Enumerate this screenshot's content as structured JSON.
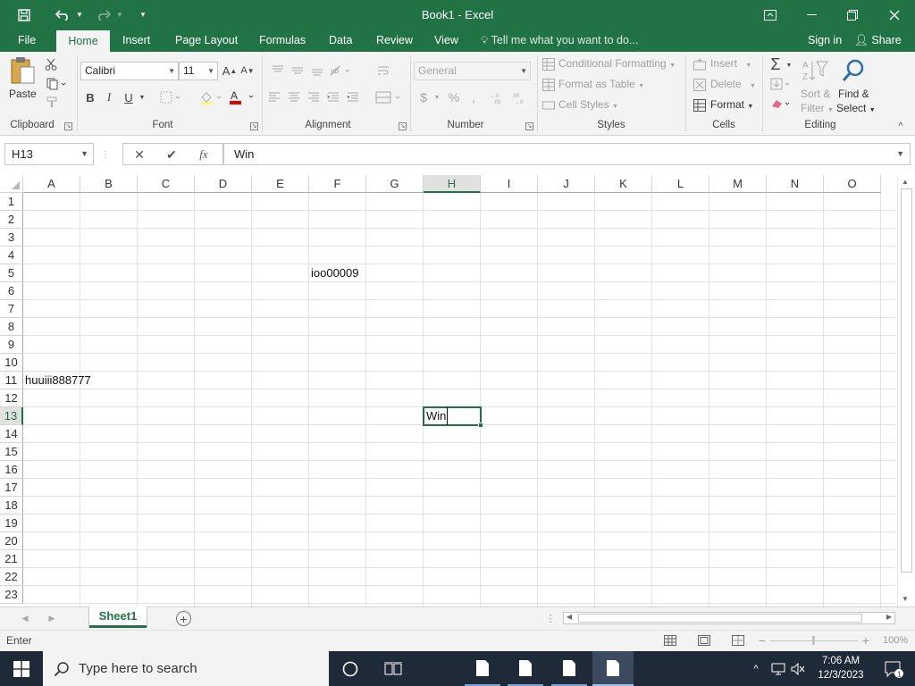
{
  "app": {
    "title": "Book1 - Excel"
  },
  "titlebar": {
    "icons": [
      "save-icon",
      "undo-icon",
      "redo-icon",
      "customize-quick-access-icon",
      "ribbon-display-options-icon",
      "minimize-icon",
      "restore-icon",
      "close-icon"
    ]
  },
  "tabs": [
    {
      "label": "File"
    },
    {
      "label": "Home",
      "active": true
    },
    {
      "label": "Insert"
    },
    {
      "label": "Page Layout"
    },
    {
      "label": "Formulas"
    },
    {
      "label": "Data"
    },
    {
      "label": "Review"
    },
    {
      "label": "View"
    }
  ],
  "tell_me": "Tell me what you want to do...",
  "signin": "Sign in",
  "share": "Share",
  "ribbon": {
    "clipboard": {
      "label": "Clipboard",
      "paste": "Paste"
    },
    "font": {
      "label": "Font",
      "name": "Calibri",
      "size": "11",
      "bold": "B",
      "italic": "I",
      "underline": "U"
    },
    "alignment": {
      "label": "Alignment"
    },
    "number": {
      "label": "Number",
      "format": "General",
      "currency": "$",
      "percent": "%"
    },
    "styles": {
      "label": "Styles",
      "conditional": "Conditional Formatting",
      "format_table": "Format as Table",
      "cell_styles": "Cell Styles"
    },
    "cells": {
      "label": "Cells",
      "insert": "Insert",
      "delete": "Delete",
      "format": "Format"
    },
    "editing": {
      "label": "Editing",
      "sort_filter_1": "Sort &",
      "sort_filter_2": "Filter",
      "find_select_1": "Find &",
      "find_select_2": "Select"
    }
  },
  "formula_bar": {
    "name_box": "H13",
    "cancel": "✕",
    "enter": "✔",
    "fx": "fx",
    "content": "Win"
  },
  "columns": [
    "A",
    "B",
    "C",
    "D",
    "E",
    "F",
    "G",
    "H",
    "I",
    "J",
    "K",
    "L",
    "M",
    "N",
    "O"
  ],
  "selected_column": "H",
  "rows": [
    "1",
    "2",
    "3",
    "4",
    "5",
    "6",
    "7",
    "8",
    "9",
    "10",
    "11",
    "12",
    "13",
    "14",
    "15",
    "16",
    "17",
    "18",
    "19",
    "20",
    "21",
    "22",
    "23"
  ],
  "selected_row": "13",
  "cells": [
    {
      "ref": "F5",
      "value": "ioo00009"
    },
    {
      "ref": "A11",
      "value": "huuiii888777"
    },
    {
      "ref": "H13",
      "value": "Win",
      "editing": true
    }
  ],
  "sheets": [
    {
      "name": "Sheet1",
      "active": true
    }
  ],
  "status": {
    "mode": "Enter",
    "zoom": "100%"
  },
  "taskbar": {
    "search_placeholder": "Type here to search",
    "time": "7:06 AM",
    "date": "12/3/2023",
    "notifications": "1"
  },
  "colors": {
    "accent": "#217346",
    "taskbar": "#1f2a38"
  }
}
